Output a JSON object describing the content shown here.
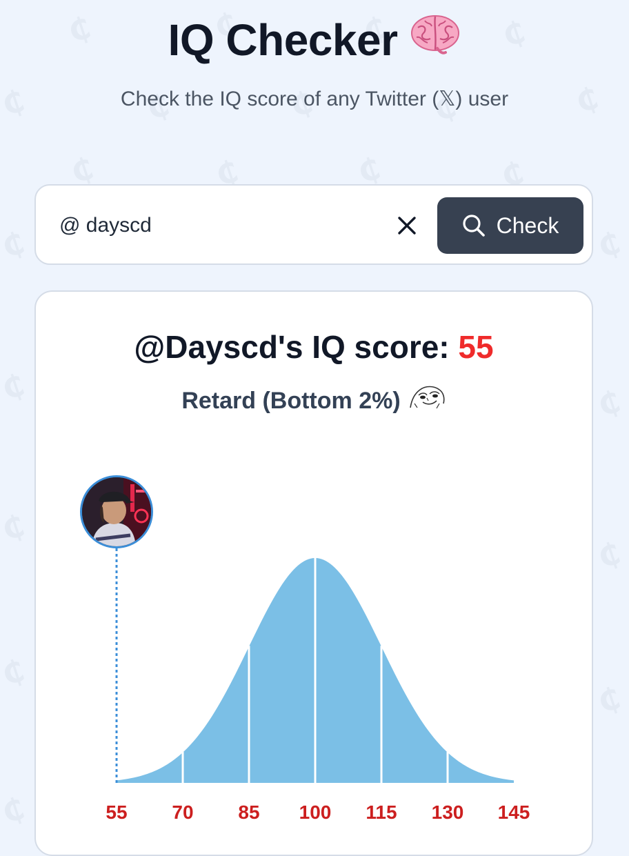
{
  "header": {
    "title": "IQ Checker",
    "title_icon": "brain-icon",
    "subtitle": "Check the IQ score of any Twitter (𝕏) user"
  },
  "search": {
    "at_prefix": "@",
    "value": "@ dayscd",
    "clear_icon": "close-icon",
    "check_label": "Check",
    "check_icon": "search-icon"
  },
  "result": {
    "heading_prefix": "@Dayscd's IQ score: ",
    "score": "55",
    "category": "Retard (Bottom 2%)",
    "category_icon": "wojak-face-icon",
    "avatar_icon": "user-avatar"
  },
  "colors": {
    "background": "#eef4fd",
    "card": "#ffffff",
    "accent_red": "#ef2b2b",
    "button_dark": "#374151",
    "curve_fill": "#7bbfe6",
    "marker_blue": "#3b8ed8"
  },
  "chart_data": {
    "type": "area",
    "title": "",
    "xlabel": "",
    "ylabel": "",
    "x_ticks": [
      55,
      70,
      85,
      100,
      115,
      130,
      145
    ],
    "x_tick_labels": [
      "55",
      "70",
      "85",
      "100",
      "115",
      "130",
      "145"
    ],
    "xlim": [
      55,
      145
    ],
    "distribution": {
      "mean": 100,
      "std_dev": 15
    },
    "marker_value": 55,
    "grid": false,
    "legend": "none"
  }
}
